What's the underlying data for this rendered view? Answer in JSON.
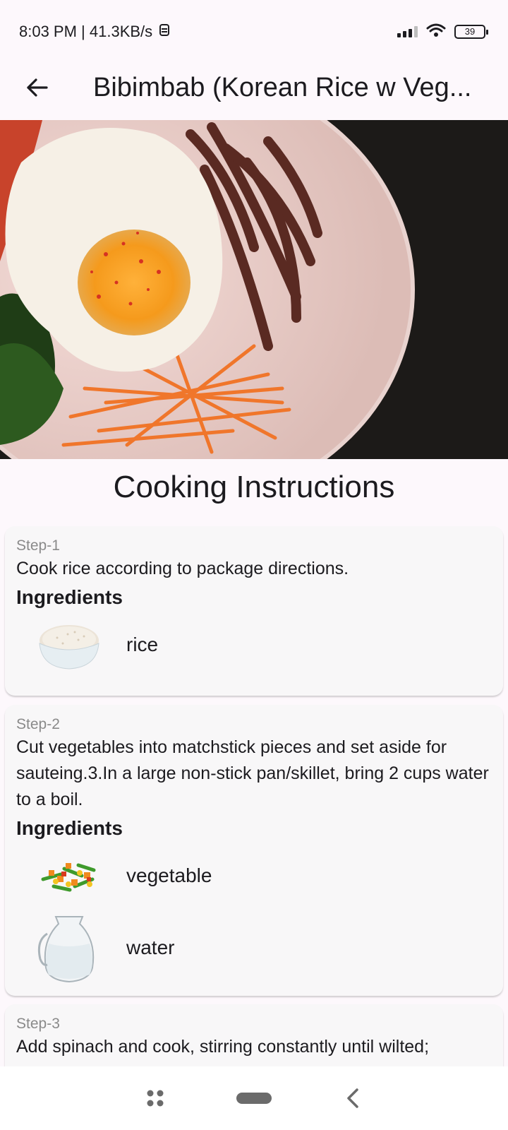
{
  "status": {
    "time_speed": "8:03 PM | 41.3KB/s",
    "battery": "39"
  },
  "app_bar": {
    "title": "Bibimbab (Korean Rice w Veg..."
  },
  "section_title": "Cooking Instructions",
  "steps": [
    {
      "label": "Step-1",
      "text": "Cook rice according to package directions.",
      "ingredients_title": "Ingredients",
      "ingredients": [
        {
          "name": "rice",
          "icon": "rice-bowl-image"
        }
      ]
    },
    {
      "label": "Step-2",
      "text": "Cut vegetables into matchstick pieces and set aside for sauteing.3.In a large non-stick pan/skillet, bring 2 cups water to a boil.",
      "ingredients_title": "Ingredients",
      "ingredients": [
        {
          "name": "vegetable",
          "icon": "mixed-vegetables-image"
        },
        {
          "name": "water",
          "icon": "water-jug-image"
        }
      ]
    },
    {
      "label": "Step-3",
      "text": "Add spinach and cook, stirring constantly until wilted;"
    }
  ],
  "colors": {
    "background": "#fdf8fc",
    "card": "#f8f7f8",
    "step_label": "#8a8a8a",
    "text": "#1c1b1f"
  }
}
